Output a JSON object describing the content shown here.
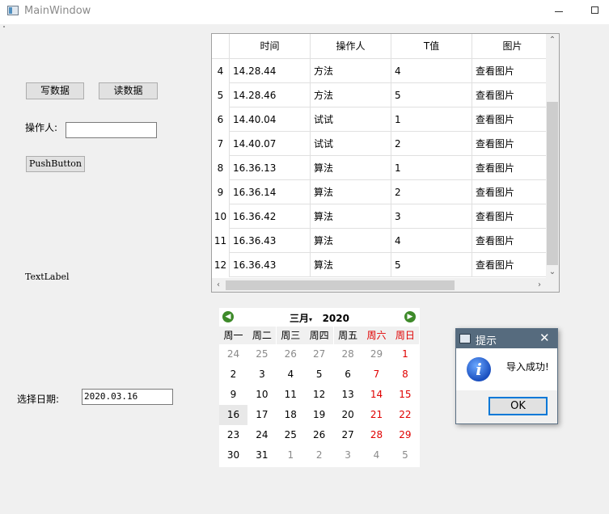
{
  "window": {
    "title": "MainWindow"
  },
  "buttons": {
    "write": "写数据",
    "read": "读数据",
    "push": "PushButton",
    "ok": "OK"
  },
  "operator": {
    "label": "操作人:",
    "value": ""
  },
  "text_label": "TextLabel",
  "date": {
    "label": "选择日期:",
    "value": "2020.03.16"
  },
  "table": {
    "headers": [
      "时间",
      "操作人",
      "T值",
      "图片"
    ],
    "rows": [
      {
        "n": "4",
        "time": "14.28.44",
        "op": "方法",
        "t": "4",
        "pic": "查看图片"
      },
      {
        "n": "5",
        "time": "14.28.46",
        "op": "方法",
        "t": "5",
        "pic": "查看图片"
      },
      {
        "n": "6",
        "time": "14.40.04",
        "op": "试试",
        "t": "1",
        "pic": "查看图片"
      },
      {
        "n": "7",
        "time": "14.40.07",
        "op": "试试",
        "t": "2",
        "pic": "查看图片"
      },
      {
        "n": "8",
        "time": "16.36.13",
        "op": "算法",
        "t": "1",
        "pic": "查看图片"
      },
      {
        "n": "9",
        "time": "16.36.14",
        "op": "算法",
        "t": "2",
        "pic": "查看图片"
      },
      {
        "n": "10",
        "time": "16.36.42",
        "op": "算法",
        "t": "3",
        "pic": "查看图片"
      },
      {
        "n": "11",
        "time": "16.36.43",
        "op": "算法",
        "t": "4",
        "pic": "查看图片"
      },
      {
        "n": "12",
        "time": "16.36.43",
        "op": "算法",
        "t": "5",
        "pic": "查看图片"
      }
    ]
  },
  "calendar": {
    "month": "三月",
    "year": "2020",
    "weekdays": [
      "周一",
      "周二",
      "周三",
      "周四",
      "周五",
      "周六",
      "周日"
    ],
    "weeks": [
      [
        "24",
        "25",
        "26",
        "27",
        "28",
        "29",
        "1"
      ],
      [
        "2",
        "3",
        "4",
        "5",
        "6",
        "7",
        "8"
      ],
      [
        "9",
        "10",
        "11",
        "12",
        "13",
        "14",
        "15"
      ],
      [
        "16",
        "17",
        "18",
        "19",
        "20",
        "21",
        "22"
      ],
      [
        "23",
        "24",
        "25",
        "26",
        "27",
        "28",
        "29"
      ],
      [
        "30",
        "31",
        "1",
        "2",
        "3",
        "4",
        "5"
      ]
    ],
    "selected": "16",
    "weekend_color": "#e00000",
    "nav_color": "#3e8a2a"
  },
  "dialog": {
    "title": "提示",
    "message": "导入成功!",
    "icon": "info-icon"
  }
}
